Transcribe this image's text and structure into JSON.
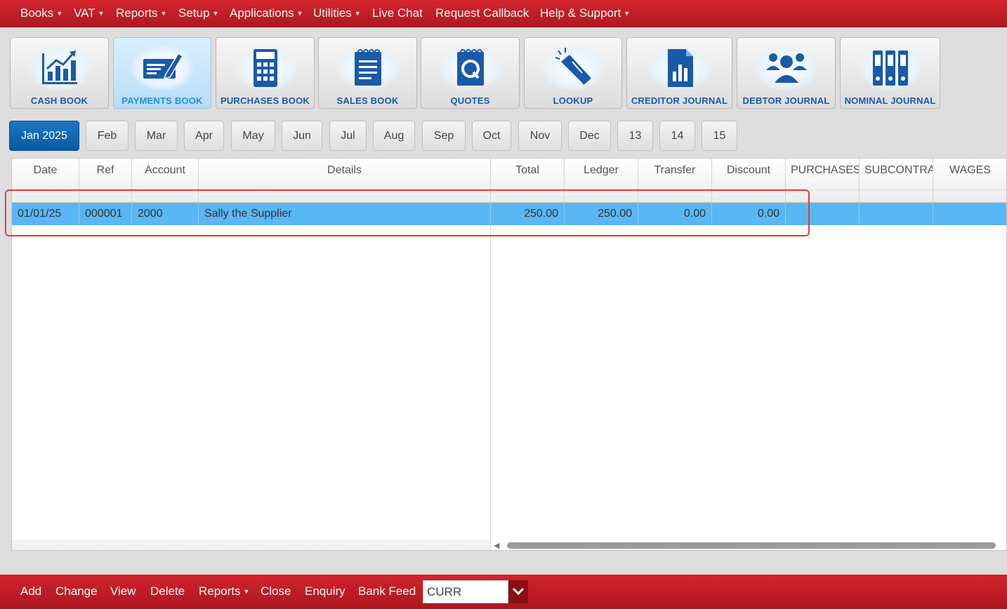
{
  "menu": [
    {
      "label": "Books",
      "caret": true
    },
    {
      "label": "VAT",
      "caret": true
    },
    {
      "label": "Reports",
      "caret": true
    },
    {
      "label": "Setup",
      "caret": true
    },
    {
      "label": "Applications",
      "caret": true
    },
    {
      "label": "Utilities",
      "caret": true
    },
    {
      "label": "Live Chat",
      "caret": false
    },
    {
      "label": "Request Callback",
      "caret": false
    },
    {
      "label": "Help & Support",
      "caret": true
    }
  ],
  "toolbar": [
    {
      "label": "CASH BOOK",
      "icon": "cash-book-chart-icon",
      "active": false
    },
    {
      "label": "PAYMENTS BOOK",
      "icon": "payments-book-cheque-icon",
      "active": true
    },
    {
      "label": "PURCHASES BOOK",
      "icon": "purchases-book-calculator-icon",
      "active": false
    },
    {
      "label": "SALES BOOK",
      "icon": "sales-book-notepad-icon",
      "active": false
    },
    {
      "label": "QUOTES",
      "icon": "quotes-notepad-icon",
      "active": false
    },
    {
      "label": "LOOKUP",
      "icon": "lookup-flashlight-icon",
      "active": false
    },
    {
      "label": "CREDITOR JOURNAL",
      "icon": "creditor-journal-document-icon",
      "active": false
    },
    {
      "label": "DEBTOR JOURNAL",
      "icon": "debtor-journal-people-icon",
      "active": false
    },
    {
      "label": "NOMINAL JOURNAL",
      "icon": "nominal-journal-binders-icon",
      "active": false
    }
  ],
  "periods": [
    "Jan 2025",
    "Feb",
    "Mar",
    "Apr",
    "May",
    "Jun",
    "Jul",
    "Aug",
    "Sep",
    "Oct",
    "Nov",
    "Dec",
    "13",
    "14",
    "15"
  ],
  "active_period": "Jan 2025",
  "table": {
    "columns": [
      "Date",
      "Ref",
      "Account",
      "Details",
      "Total",
      "Ledger",
      "Transfer",
      "Discount",
      "PURCHASES",
      "SUBCONTRA",
      "WAGES"
    ],
    "rows": [
      {
        "Date": "01/01/25",
        "Ref": "000001",
        "Account": "2000",
        "Details": "Sally the Supplier",
        "Total": "250.00",
        "Ledger": "250.00",
        "Transfer": "0.00",
        "Discount": "0.00",
        "PURCHASES": "",
        "SUBCONTRA": "",
        "WAGES": ""
      }
    ]
  },
  "bottom": {
    "actions": [
      {
        "label": "Add",
        "caret": false
      },
      {
        "label": "Change",
        "caret": false
      },
      {
        "label": "View",
        "caret": false
      },
      {
        "label": "Delete",
        "caret": false
      },
      {
        "label": "Reports",
        "caret": true
      },
      {
        "label": "Close",
        "caret": false
      },
      {
        "label": "Enquiry",
        "caret": false
      },
      {
        "label": "Bank Feed",
        "caret": false
      }
    ],
    "currency_value": "CURR"
  },
  "colors": {
    "brand_red": "#c41e26",
    "accent_blue": "#0b5aa0",
    "selected_row": "#59b7f4",
    "highlight": "#e53b3b",
    "icon_blue": "#1a5aa8"
  }
}
